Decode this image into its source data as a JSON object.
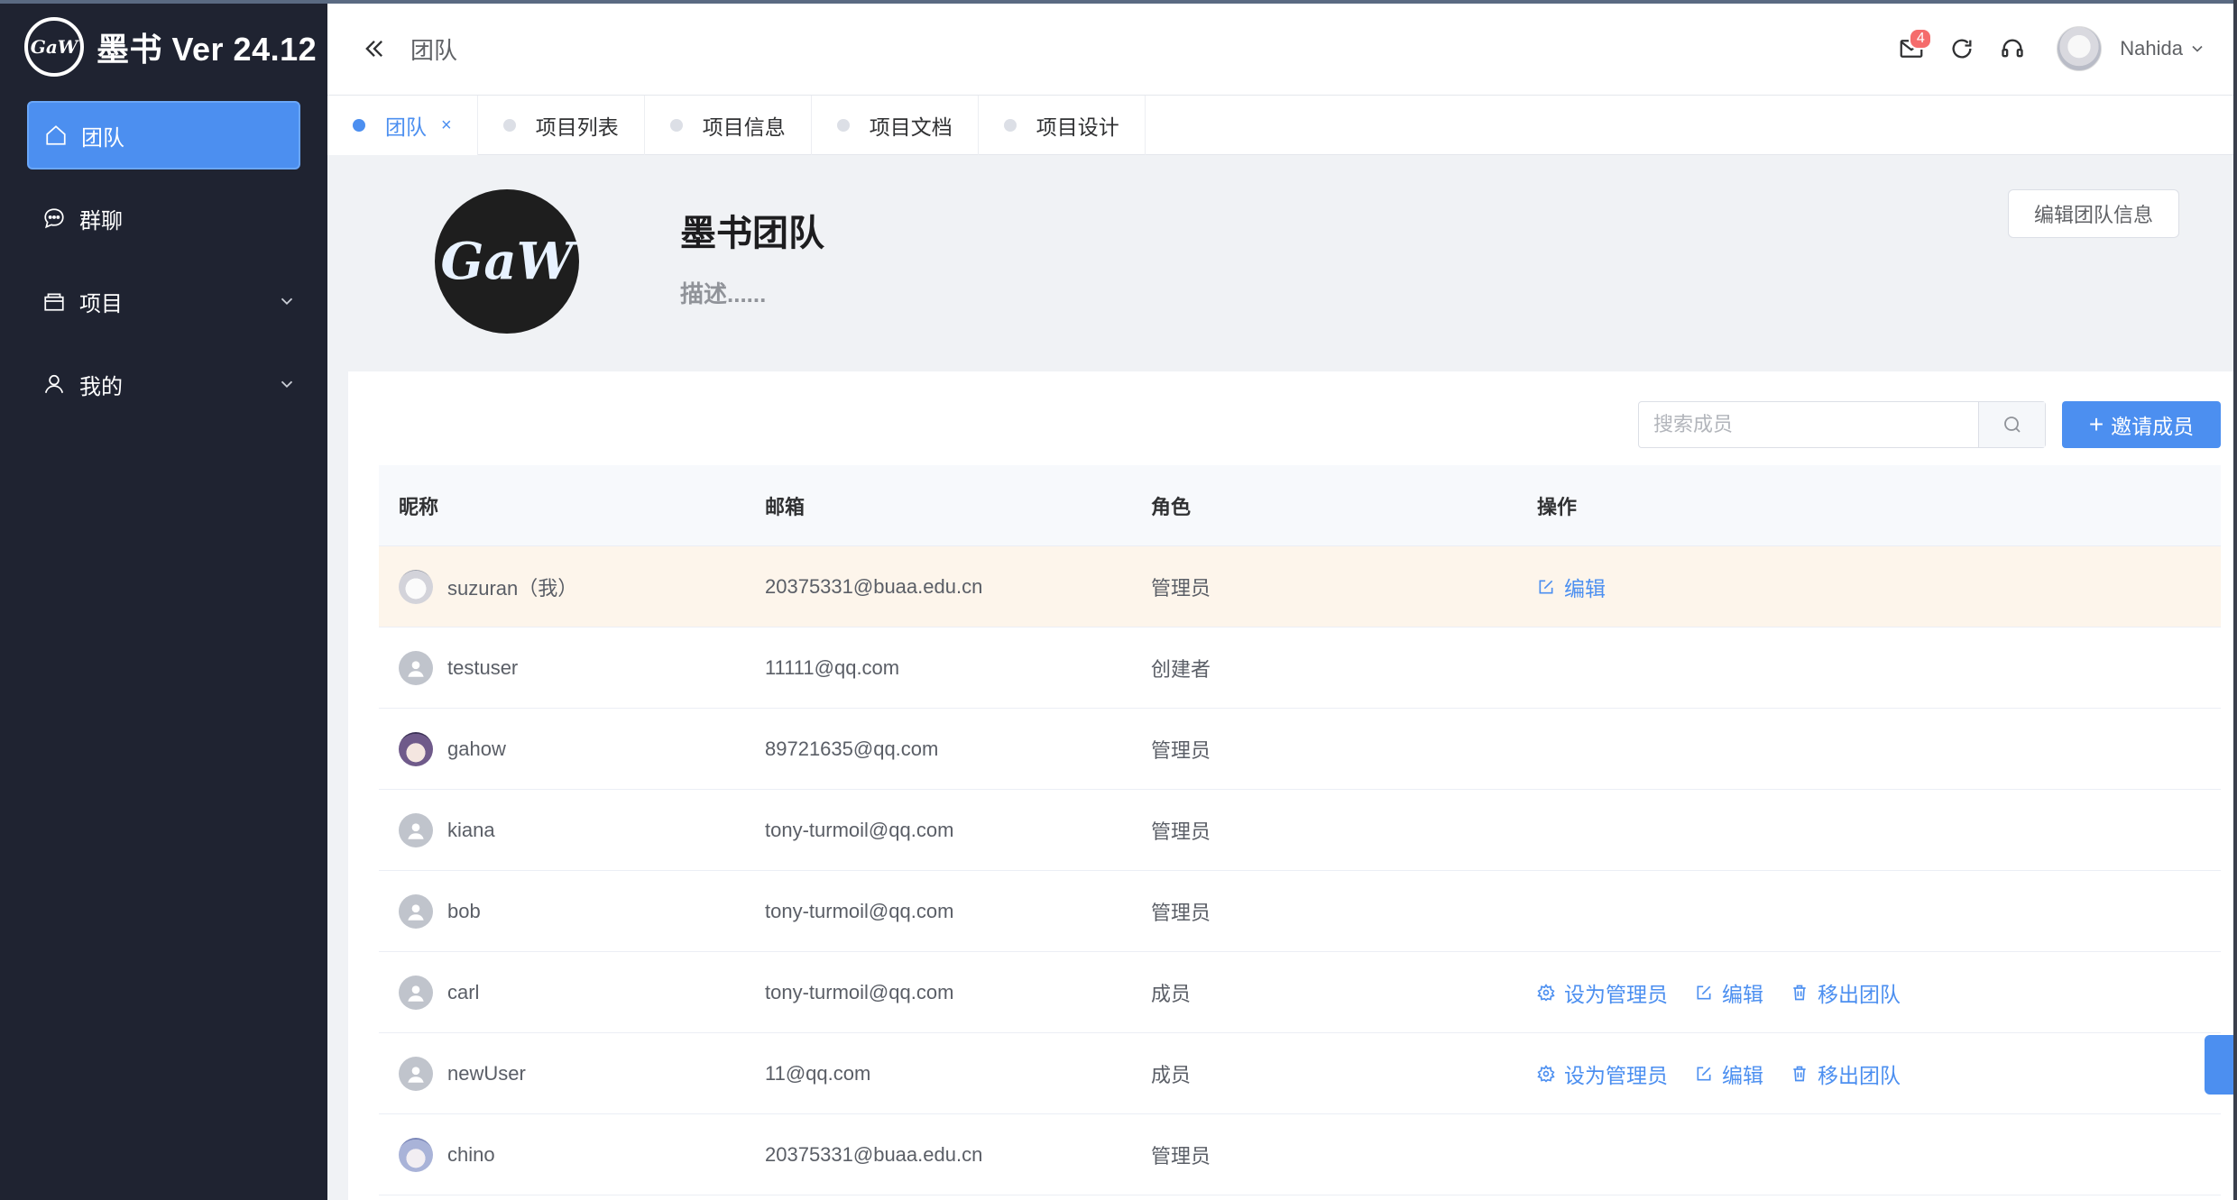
{
  "app": {
    "brand_title": "墨书 Ver 24.12",
    "logo_text": "GaW"
  },
  "sidebar": {
    "items": [
      {
        "label": "团队",
        "icon": "home-icon",
        "active": true
      },
      {
        "label": "群聊",
        "icon": "chat-icon"
      },
      {
        "label": "项目",
        "icon": "folder-icon",
        "expandable": true
      },
      {
        "label": "我的",
        "icon": "user-icon",
        "expandable": true
      }
    ]
  },
  "header": {
    "title": "团队",
    "notification_count": "4",
    "username": "Nahida"
  },
  "tabs": [
    {
      "label": "团队",
      "active": true,
      "closable": true
    },
    {
      "label": "项目列表"
    },
    {
      "label": "项目信息"
    },
    {
      "label": "项目文档"
    },
    {
      "label": "项目设计"
    }
  ],
  "team": {
    "logo_text": "GaW",
    "name": "墨书团队",
    "description": "描述......",
    "edit_button": "编辑团队信息"
  },
  "members": {
    "search_placeholder": "搜索成员",
    "invite_button": "邀请成员",
    "columns": [
      "昵称",
      "邮箱",
      "角色",
      "操作"
    ],
    "rows": [
      {
        "nickname": "suzuran（我）",
        "email": "20375331@buaa.edu.cn",
        "role": "管理员",
        "avatar": "anime1",
        "actions": [
          "编辑"
        ]
      },
      {
        "nickname": "testuser",
        "email": "11111@qq.com",
        "role": "创建者",
        "avatar": "default",
        "actions": []
      },
      {
        "nickname": "gahow",
        "email": "89721635@qq.com",
        "role": "管理员",
        "avatar": "anime2",
        "actions": []
      },
      {
        "nickname": "kiana",
        "email": "tony-turmoil@qq.com",
        "role": "管理员",
        "avatar": "default",
        "actions": []
      },
      {
        "nickname": "bob",
        "email": "tony-turmoil@qq.com",
        "role": "管理员",
        "avatar": "default",
        "actions": []
      },
      {
        "nickname": "carl",
        "email": "tony-turmoil@qq.com",
        "role": "成员",
        "avatar": "default",
        "actions": [
          "设为管理员",
          "编辑",
          "移出团队"
        ]
      },
      {
        "nickname": "newUser",
        "email": "11@qq.com",
        "role": "成员",
        "avatar": "default",
        "actions": [
          "设为管理员",
          "编辑",
          "移出团队"
        ]
      },
      {
        "nickname": "chino",
        "email": "20375331@buaa.edu.cn",
        "role": "管理员",
        "avatar": "anime3",
        "actions": []
      }
    ]
  },
  "colors": {
    "sidebar_bg": "#1f2331",
    "accent": "#4c8ff0",
    "current_user_row": "#fdf5eb"
  }
}
